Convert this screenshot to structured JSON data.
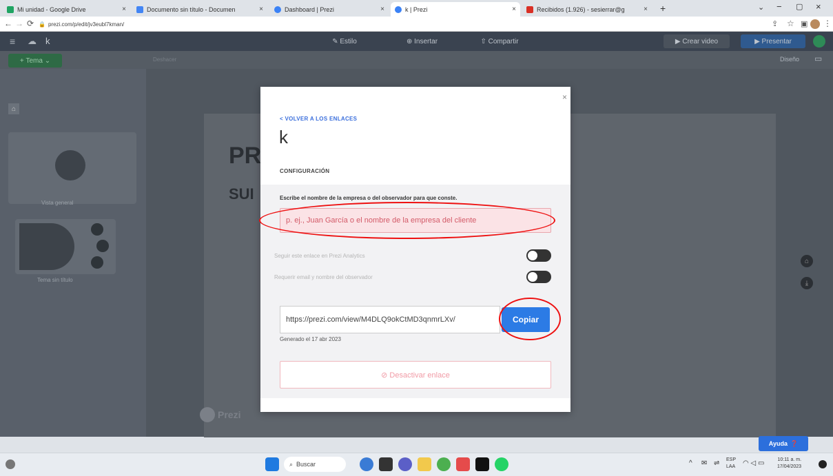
{
  "browser": {
    "tabs": [
      {
        "label": "Mi unidad - Google Drive",
        "color": "#1fa463"
      },
      {
        "label": "Documento sin título - Documen",
        "color": "#4285f4"
      },
      {
        "label": "Dashboard | Prezi",
        "color": "#3b82f6"
      },
      {
        "label": "k | Prezi",
        "color": "#3b82f6"
      },
      {
        "label": "Recibidos (1.926) - sesierrar@g",
        "color": "#d93025"
      }
    ],
    "new_tab": "+",
    "url": "prezi.com/p/edit/jv3eubl7kman/"
  },
  "app": {
    "title": "k",
    "menu": [
      "Estilo",
      "Insertar",
      "Compartir"
    ],
    "create_video": "Crear video",
    "present": "Presentar",
    "theme_button": "Tema",
    "overview_label": "Vista general",
    "untitled_topic": "Tema sin título",
    "design_label": "Diseño",
    "subbar_left": "Deshacer",
    "canvas_title": "PR",
    "canvas_subtitle": "SUI",
    "prezi_logo": "Prezi",
    "help_button": "Ayuda"
  },
  "modal": {
    "back_link": "< VOLVER A LOS ENLACES",
    "title": "k",
    "section_label": "CONFIGURACIÓN",
    "instruction": "Escribe el nombre de la empresa o del observador para que conste.",
    "viewer_placeholder": "p. ej., Juan García o el nombre de la empresa del cliente",
    "toggle_analytics": "Seguir este enlace en Prezi Analytics",
    "toggle_require": "Requerir email y nombre del observador",
    "share_url": "https://prezi.com/view/M4DLQ9okCtMD3qnmrLXv/",
    "copy_button": "Copiar",
    "generated": "Generado el 17 abr 2023",
    "deactivate": "⊘ Desactivar enlace",
    "close": "×"
  },
  "taskbar": {
    "search": "Buscar",
    "lang": "ESP",
    "lang2": "LAA",
    "time": "10:11 a. m.",
    "date": "17/04/2023"
  }
}
